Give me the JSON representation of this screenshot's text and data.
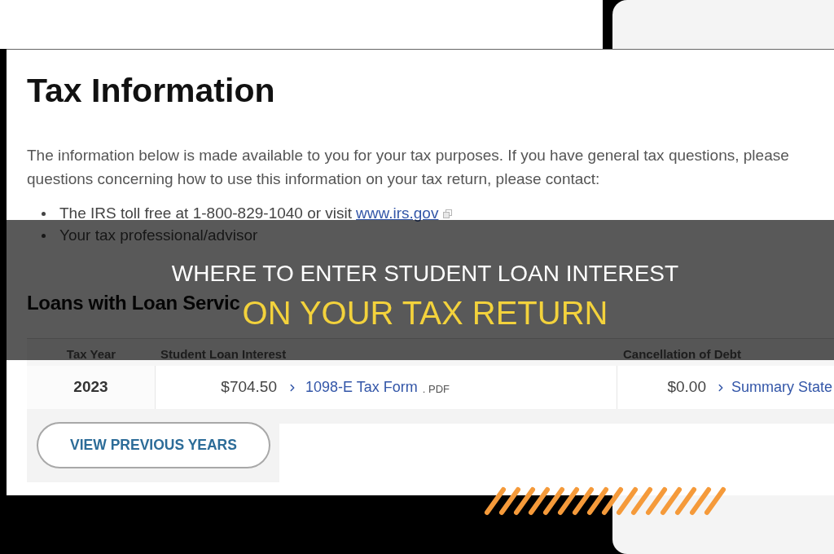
{
  "tax_page": {
    "heading": "Tax Information",
    "intro_lines": [
      "The information below is made available to you for your tax purposes. If you have general tax questions, please",
      "questions concerning how to use this information on your tax return, please contact:"
    ],
    "contacts": [
      {
        "text": "The IRS toll free at 1-800-829-1040 or visit",
        "link": "www.irs.gov"
      },
      {
        "text": "Your tax professional/advisor"
      }
    ],
    "section_heading": "Loans with Loan Servic",
    "table": {
      "columns": [
        "Tax Year",
        "Student Loan Interest",
        "Cancellation of Debt"
      ],
      "rows": [
        {
          "tax_year": "2023",
          "interest": "$704.50",
          "interest_link": "1098-E Tax Form",
          "interest_file_type": ". PDF",
          "debt": "$0.00",
          "debt_link": "Summary State"
        }
      ]
    },
    "button": "VIEW PREVIOUS YEARS"
  },
  "banner": {
    "title_lines": [
      {
        "text": "WHERE TO ENTER STUDENT LOAN INTEREST",
        "color": "#ffffff"
      },
      {
        "text": "ON YOUR TAX RETURN",
        "color": "#f3d23c"
      }
    ]
  }
}
